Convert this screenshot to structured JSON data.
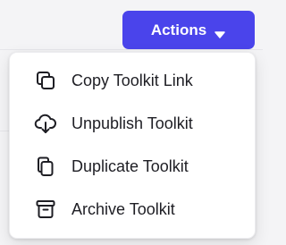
{
  "header": {
    "actions_label": "Actions",
    "actions_icon": "caret-down-icon",
    "accent_color": "#4a44eb"
  },
  "menu": {
    "items": [
      {
        "label": "Copy Toolkit Link",
        "icon": "copy-icon"
      },
      {
        "label": "Unpublish Toolkit",
        "icon": "cloud-download-icon"
      },
      {
        "label": "Duplicate Toolkit",
        "icon": "duplicate-icon"
      },
      {
        "label": "Archive Toolkit",
        "icon": "archive-icon"
      }
    ]
  }
}
